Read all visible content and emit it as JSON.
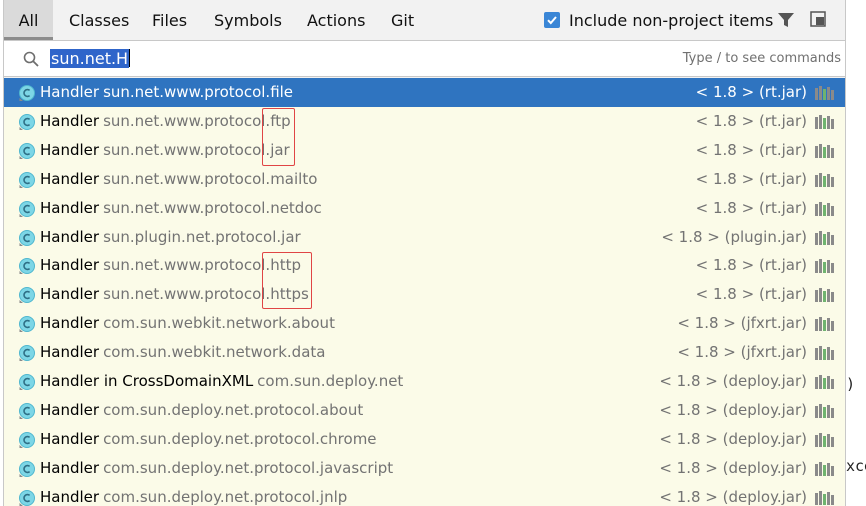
{
  "tabs": [
    {
      "label": "All",
      "active": true
    },
    {
      "label": "Classes",
      "active": false
    },
    {
      "label": "Files",
      "active": false
    },
    {
      "label": "Symbols",
      "active": false
    },
    {
      "label": "Actions",
      "active": false
    },
    {
      "label": "Git",
      "active": false
    }
  ],
  "include_non_project": {
    "label": "Include non-project items",
    "checked": true
  },
  "search": {
    "query": "sun.net.H",
    "hint": "Type / to see commands"
  },
  "results": [
    {
      "name": "Handler",
      "package": "sun.net.www.protocol.file",
      "location": "< 1.8 > (rt.jar)",
      "selected": true
    },
    {
      "name": "Handler",
      "package": "sun.net.www.protocol.ftp",
      "location": "< 1.8 > (rt.jar)"
    },
    {
      "name": "Handler",
      "package": "sun.net.www.protocol.jar",
      "location": "< 1.8 > (rt.jar)"
    },
    {
      "name": "Handler",
      "package": "sun.net.www.protocol.mailto",
      "location": "< 1.8 > (rt.jar)"
    },
    {
      "name": "Handler",
      "package": "sun.net.www.protocol.netdoc",
      "location": "< 1.8 > (rt.jar)"
    },
    {
      "name": "Handler",
      "package": "sun.plugin.net.protocol.jar",
      "location": "< 1.8 > (plugin.jar)"
    },
    {
      "name": "Handler",
      "package": "sun.net.www.protocol.http",
      "location": "< 1.8 > (rt.jar)"
    },
    {
      "name": "Handler",
      "package": "sun.net.www.protocol.https",
      "location": "< 1.8 > (rt.jar)"
    },
    {
      "name": "Handler",
      "package": "com.sun.webkit.network.about",
      "location": "< 1.8 > (jfxrt.jar)"
    },
    {
      "name": "Handler",
      "package": "com.sun.webkit.network.data",
      "location": "< 1.8 > (jfxrt.jar)"
    },
    {
      "name": "Handler in CrossDomainXML",
      "package": "com.sun.deploy.net",
      "location": "< 1.8 > (deploy.jar)"
    },
    {
      "name": "Handler",
      "package": "com.sun.deploy.net.protocol.about",
      "location": "< 1.8 > (deploy.jar)"
    },
    {
      "name": "Handler",
      "package": "com.sun.deploy.net.protocol.chrome",
      "location": "< 1.8 > (deploy.jar)"
    },
    {
      "name": "Handler",
      "package": "com.sun.deploy.net.protocol.javascript",
      "location": "< 1.8 > (deploy.jar)"
    },
    {
      "name": "Handler",
      "package": "com.sun.deploy.net.protocol.jnlp",
      "location": "< 1.8 > (deploy.jar)"
    }
  ],
  "background_code": [
    ")",
    "xce"
  ],
  "colors": {
    "accent": "#3a86d6",
    "selection": "#2f74c0",
    "list_background": "#fbfbe8",
    "highlight_box": "#e04545"
  },
  "icons": {
    "class": "class-icon",
    "library": "library-icon",
    "filter": "filter-icon",
    "pin": "pin-window-icon",
    "search": "search-icon",
    "check": "check-icon"
  }
}
